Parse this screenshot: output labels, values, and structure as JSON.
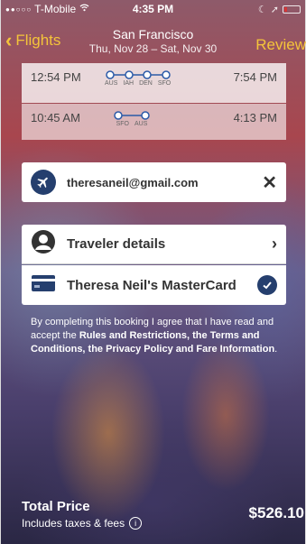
{
  "status_bar": {
    "carrier": "T-Mobile",
    "time": "4:35 PM",
    "signal_dots": "●●○○○",
    "wifi_icon": "wifi-icon",
    "moon_icon": "moon-icon",
    "location_icon": "location-arrow-icon",
    "battery_level": 0.15
  },
  "nav": {
    "back_label": "Flights",
    "title": "San Francisco",
    "subtitle": "Thu, Nov 28 – Sat, Nov 30",
    "review_label": "Review"
  },
  "flights": [
    {
      "depart": "12:54 PM",
      "arrive": "7:54 PM",
      "stops": [
        "AUS",
        "IAH",
        "DEN",
        "SFO"
      ]
    },
    {
      "depart": "10:45 AM",
      "arrive": "4:13 PM",
      "stops": [
        "SFO",
        "AUS"
      ]
    }
  ],
  "email": {
    "value": "theresaneil@gmail.com"
  },
  "traveler": {
    "label": "Traveler details"
  },
  "payment": {
    "label": "Theresa Neil's MasterCard"
  },
  "terms": {
    "prefix": "By completing this booking I agree that I have read and accept the ",
    "bold": "Rules and Restrictions, the Terms and Conditions, the Privacy Policy and Fare Information",
    "suffix": "."
  },
  "total": {
    "label": "Total Price",
    "sublabel": "Includes taxes & fees",
    "price": "$526.10"
  },
  "colors": {
    "accent": "#f4c43a",
    "brand": "#253f6e"
  }
}
